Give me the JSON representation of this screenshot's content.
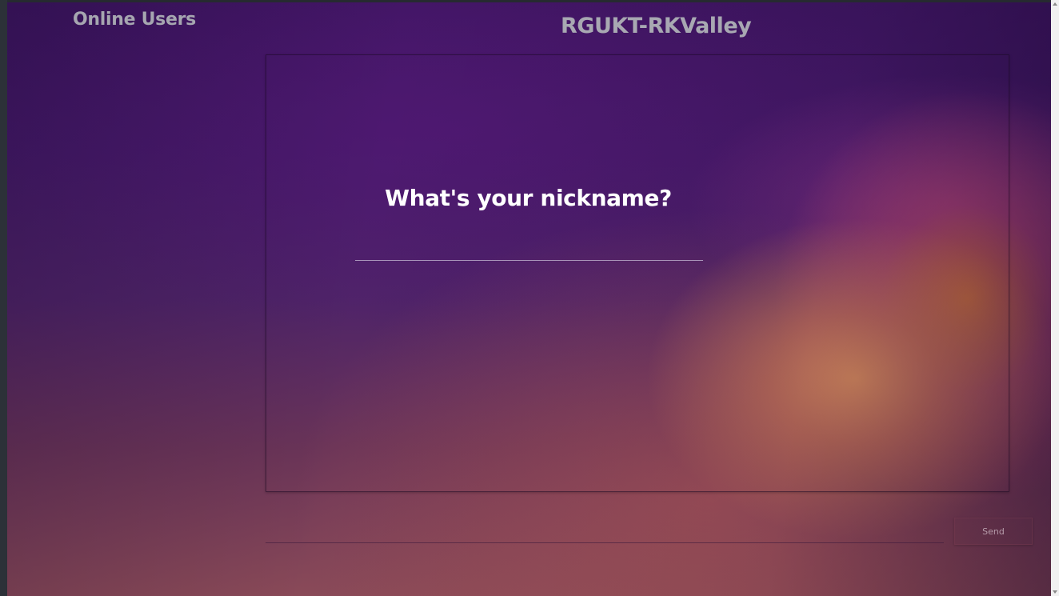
{
  "sidebar": {
    "title": "Online Users"
  },
  "header": {
    "title": "RGUKT-RKValley"
  },
  "nickname": {
    "prompt": "What's your nickname?",
    "value": "",
    "placeholder": ""
  },
  "composer": {
    "message_value": "",
    "message_placeholder": "",
    "send_label": "Send"
  },
  "colors": {
    "title_text": "#a8a8b2",
    "prompt_text": "#ffffff",
    "background_top": "#3e1562",
    "background_accent": "#e6965f"
  }
}
